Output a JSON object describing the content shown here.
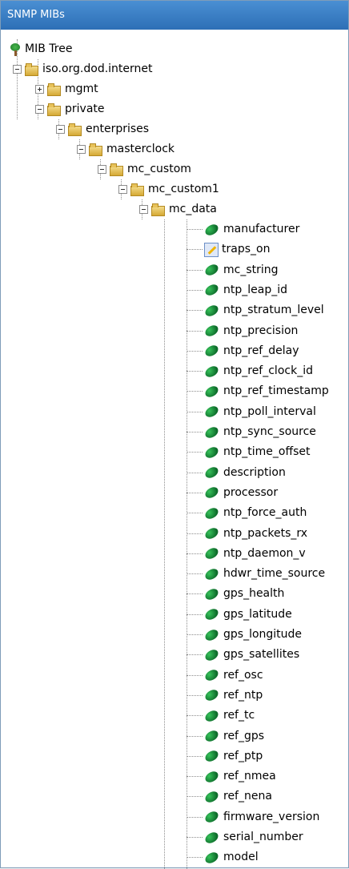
{
  "panel": {
    "title": "SNMP MIBs"
  },
  "tree": {
    "root": "MIB Tree",
    "nodes": {
      "internet": "iso.org.dod.internet",
      "mgmt": "mgmt",
      "private": "private",
      "enterprises": "enterprises",
      "masterclock": "masterclock",
      "mc_custom": "mc_custom",
      "mc_custom1": "mc_custom1",
      "mc_data": "mc_data"
    },
    "leaves": [
      {
        "label": "manufacturer",
        "icon": "leaf-icon"
      },
      {
        "label": "traps_on",
        "icon": "edit-icon"
      },
      {
        "label": "mc_string",
        "icon": "leaf-icon"
      },
      {
        "label": "ntp_leap_id",
        "icon": "leaf-icon"
      },
      {
        "label": "ntp_stratum_level",
        "icon": "leaf-icon"
      },
      {
        "label": "ntp_precision",
        "icon": "leaf-icon"
      },
      {
        "label": "ntp_ref_delay",
        "icon": "leaf-icon"
      },
      {
        "label": "ntp_ref_clock_id",
        "icon": "leaf-icon"
      },
      {
        "label": "ntp_ref_timestamp",
        "icon": "leaf-icon"
      },
      {
        "label": "ntp_poll_interval",
        "icon": "leaf-icon"
      },
      {
        "label": "ntp_sync_source",
        "icon": "leaf-icon"
      },
      {
        "label": "ntp_time_offset",
        "icon": "leaf-icon"
      },
      {
        "label": "description",
        "icon": "leaf-icon"
      },
      {
        "label": "processor",
        "icon": "leaf-icon"
      },
      {
        "label": "ntp_force_auth",
        "icon": "leaf-icon"
      },
      {
        "label": "ntp_packets_rx",
        "icon": "leaf-icon"
      },
      {
        "label": "ntp_daemon_v",
        "icon": "leaf-icon"
      },
      {
        "label": "hdwr_time_source",
        "icon": "leaf-icon"
      },
      {
        "label": "gps_health",
        "icon": "leaf-icon"
      },
      {
        "label": "gps_latitude",
        "icon": "leaf-icon"
      },
      {
        "label": "gps_longitude",
        "icon": "leaf-icon"
      },
      {
        "label": "gps_satellites",
        "icon": "leaf-icon"
      },
      {
        "label": "ref_osc",
        "icon": "leaf-icon"
      },
      {
        "label": "ref_ntp",
        "icon": "leaf-icon"
      },
      {
        "label": "ref_tc",
        "icon": "leaf-icon"
      },
      {
        "label": "ref_gps",
        "icon": "leaf-icon"
      },
      {
        "label": "ref_ptp",
        "icon": "leaf-icon"
      },
      {
        "label": "ref_nmea",
        "icon": "leaf-icon"
      },
      {
        "label": "ref_nena",
        "icon": "leaf-icon"
      },
      {
        "label": "firmware_version",
        "icon": "leaf-icon"
      },
      {
        "label": "serial_number",
        "icon": "leaf-icon"
      },
      {
        "label": "model",
        "icon": "leaf-icon"
      }
    ]
  }
}
